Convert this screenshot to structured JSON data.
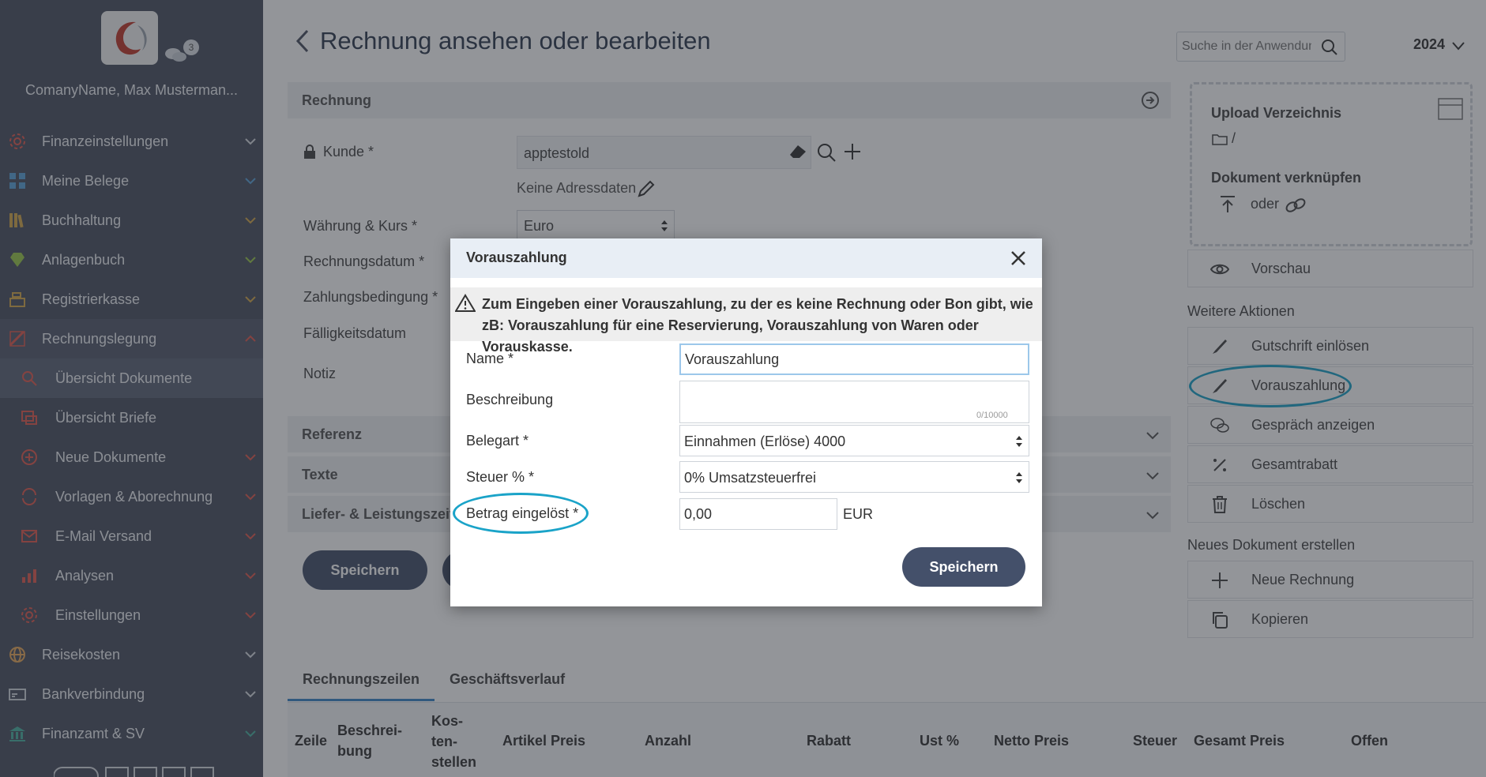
{
  "sidebar": {
    "company_name": "ComanyName, Max Musterman...",
    "chat_count": "3",
    "items": [
      {
        "label": "Finanzeinstellungen",
        "icon": "gear-icon"
      },
      {
        "label": "Meine Belege",
        "icon": "grid-icon"
      },
      {
        "label": "Buchhaltung",
        "icon": "books-icon"
      },
      {
        "label": "Anlagenbuch",
        "icon": "diamond-icon"
      },
      {
        "label": "Registrierkasse",
        "icon": "cash-register-icon"
      },
      {
        "label": "Rechnungslegung",
        "icon": "invoice-icon"
      },
      {
        "label": "Übersicht Dokumente",
        "icon": "search-doc-icon"
      },
      {
        "label": "Übersicht Briefe",
        "icon": "letter-icon"
      },
      {
        "label": "Neue Dokumente",
        "icon": "plus-circle-icon"
      },
      {
        "label": "Vorlagen & Aborechnung",
        "icon": "repeat-icon"
      },
      {
        "label": "E-Mail Versand",
        "icon": "email-icon"
      },
      {
        "label": "Analysen",
        "icon": "chart-icon"
      },
      {
        "label": "Einstellungen",
        "icon": "gear-icon"
      },
      {
        "label": "Reisekosten",
        "icon": "globe-icon"
      },
      {
        "label": "Bankverbindung",
        "icon": "bank-card-icon"
      },
      {
        "label": "Finanzamt & SV",
        "icon": "government-icon"
      }
    ]
  },
  "header": {
    "title": "Rechnung ansehen oder bearbeiten",
    "search_placeholder": "Suche in der Anwendungshilfe",
    "year": "2024"
  },
  "invoice": {
    "section_title": "Rechnung",
    "kunde_label": "Kunde *",
    "kunde_value": "apptestold",
    "no_address": "Keine Adressdaten",
    "waehrung_label": "Währung & Kurs *",
    "waehrung_value": "Euro",
    "rechnungsdatum_label": "Rechnungsdatum *",
    "zahlungsbedingung_label": "Zahlungsbedingung *",
    "faelligkeit_label": "Fälligkeitsdatum",
    "notiz_label": "Notiz",
    "sections": [
      "Referenz",
      "Texte",
      "Liefer- & Leistungszeitraum"
    ],
    "save_label": "Speichern"
  },
  "tabs": [
    "Rechnungszeilen",
    "Geschäftsverlauf"
  ],
  "table_headers": [
    "Zeile",
    "Beschrei-\nbung",
    "Kos-\nten-\nstellen",
    "Artikel Preis",
    "Anzahl",
    "Rabatt",
    "Ust %",
    "Netto Preis",
    "Steuer",
    "Gesamt Preis",
    "Offen"
  ],
  "right": {
    "upload_title": "Upload Verzeichnis",
    "upload_path": "/",
    "link_title": "Dokument verknüpfen",
    "oder": "oder",
    "preview": "Vorschau",
    "more_actions_title": "Weitere Aktionen",
    "more_actions": [
      {
        "label": "Gutschrift einlösen",
        "icon": "brush-icon"
      },
      {
        "label": "Vorauszahlung",
        "icon": "brush-icon"
      },
      {
        "label": "Gespräch anzeigen",
        "icon": "chat-icon"
      },
      {
        "label": "Gesamtrabatt",
        "icon": "percent-icon"
      },
      {
        "label": "Löschen",
        "icon": "trash-icon"
      }
    ],
    "new_doc_title": "Neues Dokument erstellen",
    "new_doc_actions": [
      {
        "label": "Neue Rechnung",
        "icon": "plus-icon"
      },
      {
        "label": "Kopieren",
        "icon": "copy-icon"
      }
    ]
  },
  "modal": {
    "title": "Vorauszahlung",
    "warning": "Zum Eingeben einer Vorauszahlung, zu der es keine Rechnung oder Bon gibt, wie zB: Vorauszahlung für eine Reservierung, Vorauszahlung von Waren oder Vorauskasse.",
    "name_label": "Name *",
    "name_value": "Vorauszahlung",
    "beschreibung_label": "Beschreibung",
    "char_counter": "0/10000",
    "belegart_label": "Belegart *",
    "belegart_value": "Einnahmen (Erlöse) 4000",
    "steuer_label": "Steuer % *",
    "steuer_value": "0% Umsatzsteuerfrei",
    "betrag_label": "Betrag eingelöst *",
    "betrag_value": "0,00",
    "currency": "EUR",
    "save_label": "Speichern"
  },
  "colors": {
    "sidebar_bg": "#4a5060",
    "primary_button": "#44506a",
    "annotation_circle": "#1aa3c8",
    "modal_header": "#e8eef5"
  }
}
